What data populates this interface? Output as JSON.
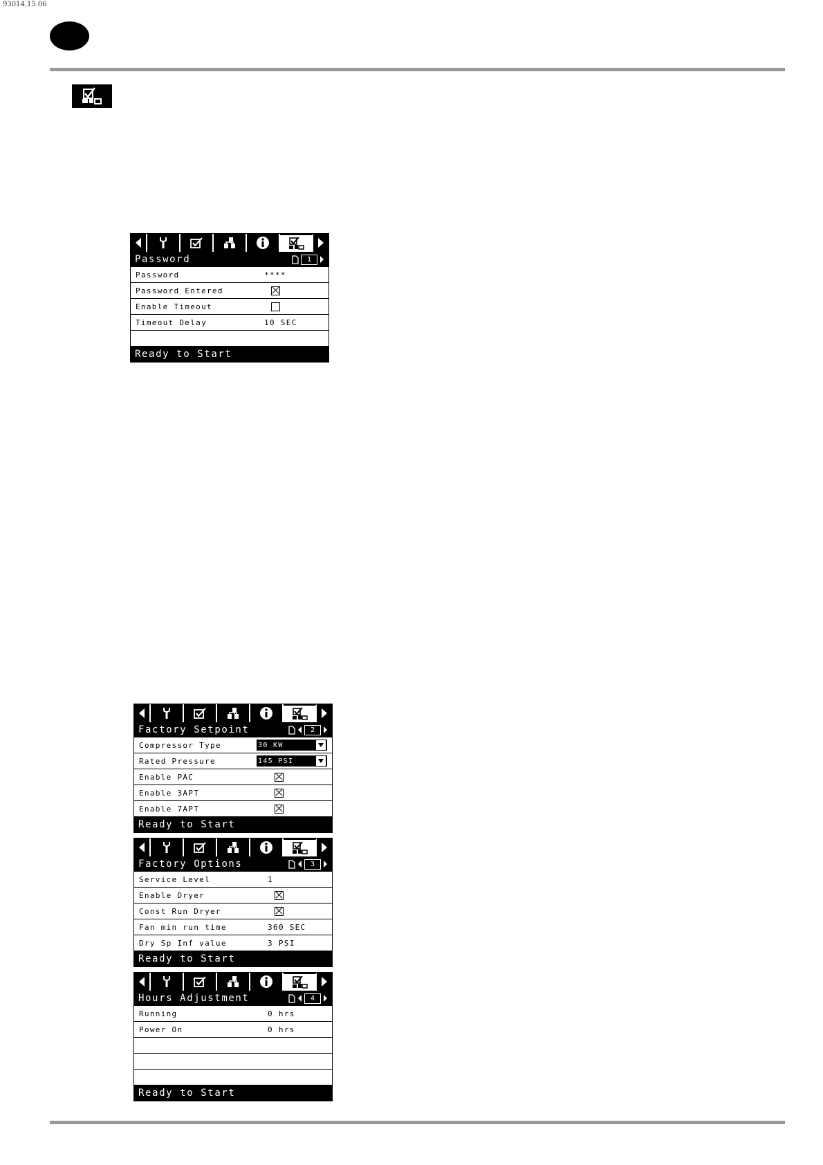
{
  "document": {
    "code": "93014.15.06"
  },
  "nav_tabs": [
    "prev-arrow",
    "wrench-icon",
    "checklist-icon",
    "network-icon",
    "info-icon",
    "factory-settings-icon",
    "next-arrow"
  ],
  "screens": [
    {
      "title": "Password",
      "page": "1",
      "rows": [
        {
          "label": "Password",
          "value": "****",
          "type": "text"
        },
        {
          "label": "Password Entered",
          "type": "checkbox",
          "checked": true
        },
        {
          "label": "Enable Timeout",
          "type": "checkbox",
          "checked": false
        },
        {
          "label": "Timeout Delay",
          "value": "10 SEC",
          "type": "text"
        },
        {
          "label": "",
          "type": "empty"
        }
      ],
      "status": "Ready to Start"
    },
    {
      "title": "Factory Setpoint",
      "page": "2",
      "rows": [
        {
          "label": "Compressor Type",
          "value": "30 KW",
          "type": "dropdown"
        },
        {
          "label": "Rated Pressure",
          "value": "145 PSI",
          "type": "dropdown"
        },
        {
          "label": "Enable PAC",
          "type": "checkbox",
          "checked": true
        },
        {
          "label": "Enable 3APT",
          "type": "checkbox",
          "checked": true
        },
        {
          "label": "Enable 7APT",
          "type": "checkbox",
          "checked": true
        }
      ],
      "status": "Ready to Start"
    },
    {
      "title": "Factory Options",
      "page": "3",
      "rows": [
        {
          "label": "Service Level",
          "value": "1",
          "type": "text"
        },
        {
          "label": "Enable Dryer",
          "type": "checkbox",
          "checked": true
        },
        {
          "label": "Const Run Dryer",
          "type": "checkbox",
          "checked": true
        },
        {
          "label": "Fan min run time",
          "value": "360 SEC",
          "type": "text"
        },
        {
          "label": "Dry Sp Inf value",
          "value": "3 PSI",
          "type": "text"
        }
      ],
      "status": "Ready to Start"
    },
    {
      "title": "Hours Adjustment",
      "page": "4",
      "rows": [
        {
          "label": "Running",
          "value": "0 hrs",
          "type": "text"
        },
        {
          "label": "Power On",
          "value": "0 hrs",
          "type": "text"
        },
        {
          "label": "",
          "type": "empty"
        },
        {
          "label": "",
          "type": "empty"
        },
        {
          "label": "",
          "type": "empty"
        }
      ],
      "status": "Ready to Start"
    }
  ]
}
